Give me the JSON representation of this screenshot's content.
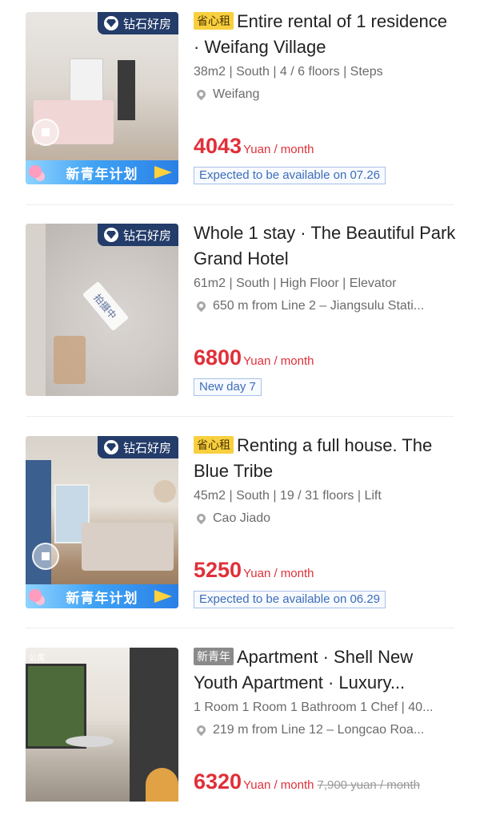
{
  "listings": [
    {
      "diamond_badge": "钻石好房",
      "tag": "省心租",
      "title": "Entire rental of 1 residence · Weifang Village",
      "specs": "38m2 | South | 4 / 6 floors | Steps",
      "location": "Weifang",
      "price": "4043",
      "unit": "Yuan / month",
      "availability": "Expected to be available on 07.26",
      "banner": "新青年计划"
    },
    {
      "diamond_badge": "钻石好房",
      "photo_tag": "拍摄中",
      "title": "Whole 1 stay · The Beautiful Park Grand Hotel",
      "specs": "61m2 | South | High Floor | Elevator",
      "location": "650 m from Line 2 – Jiangsulu Stati...",
      "price": "6800",
      "unit": "Yuan / month",
      "availability": "New day 7"
    },
    {
      "diamond_badge": "钻石好房",
      "tag": "省心租",
      "title": "Renting a full house. The Blue Tribe",
      "specs": "45m2 | South | 19 / 31 floors | Lift",
      "location": "Cao Jiado",
      "price": "5250",
      "unit": "Yuan / month",
      "availability": "Expected to be available on 06.29",
      "banner": "新青年计划"
    },
    {
      "tag": "新青年",
      "photo_watermark": "公寓",
      "title": "Apartment · Shell New Youth Apartment · Luxury...",
      "specs": "1 Room 1 Room 1 Bathroom 1 Chef | 40...",
      "location": "219 m from Line 12 – Longcao Roa...",
      "price": "6320",
      "unit": "Yuan / month",
      "original_price": "7,900 yuan / month"
    }
  ],
  "colors": {
    "price_red": "#e0303a",
    "badge_navy": "#233c69",
    "tag_yellow": "#f8cf3e",
    "availability_blue": "#3d6db8"
  }
}
